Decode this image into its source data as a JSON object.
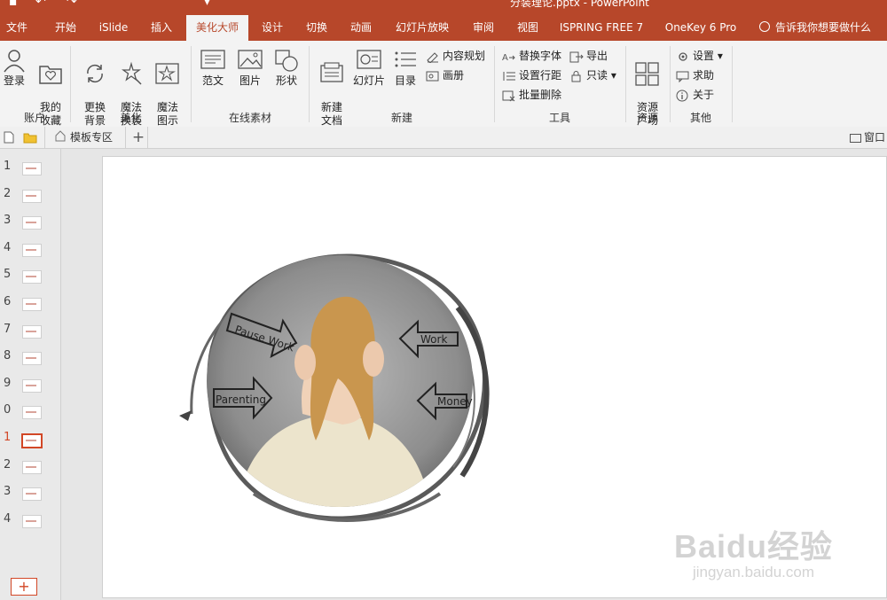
{
  "title_bar": {
    "doc_title": "分装理论.pptx - PowerPoint"
  },
  "tabs": [
    {
      "label": "文件"
    },
    {
      "label": "开始"
    },
    {
      "label": "iSlide"
    },
    {
      "label": "插入"
    },
    {
      "label": "美化大师"
    },
    {
      "label": "设计"
    },
    {
      "label": "切换"
    },
    {
      "label": "动画"
    },
    {
      "label": "幻灯片放映"
    },
    {
      "label": "审阅"
    },
    {
      "label": "视图"
    },
    {
      "label": "ISPRING FREE 7"
    },
    {
      "label": "OneKey 6 Pro"
    }
  ],
  "tell_me": "告诉我你想要做什么",
  "ribbon": {
    "account": {
      "label": "账户",
      "login": "登录",
      "fav": "我的\n收藏"
    },
    "beautify": {
      "label": "美化",
      "bg": "更换\n背景",
      "magic_swap": "魔法\n换装",
      "magic_icon": "魔法\n图示"
    },
    "online": {
      "label": "在线素材",
      "sample": "范文",
      "picture": "图片",
      "shape": "形状"
    },
    "new": {
      "label": "新建",
      "new_doc": "新建\n文档",
      "slide": "幻灯片",
      "toc": "目录",
      "content_plan": "内容规划",
      "album": "画册"
    },
    "tools": {
      "label": "工具",
      "replace_font": "替换字体",
      "line_spacing": "设置行距",
      "batch_delete": "批量删除",
      "export": "导出",
      "readonly": "只读"
    },
    "resource": {
      "label": "资源",
      "square": "资源\n广场"
    },
    "other": {
      "label": "其他",
      "settings": "设置",
      "help": "求助",
      "about": "关于"
    }
  },
  "subbar": {
    "template_zone": "模板专区",
    "window": "窗口"
  },
  "slides": [
    "1",
    "2",
    "3",
    "4",
    "5",
    "6",
    "7",
    "8",
    "9",
    "0",
    "1",
    "2",
    "3",
    "4"
  ],
  "active_slide_index": 10,
  "slide_image_text": {
    "arrow1": "Pause Work",
    "arrow2": "Parenting",
    "arrow3": "Work",
    "arrow4": "Money"
  },
  "watermark": {
    "big": "Baidu经验",
    "small": "jingyan.baidu.com"
  },
  "colors": {
    "accent": "#b7472a",
    "active_red": "#d24726"
  }
}
